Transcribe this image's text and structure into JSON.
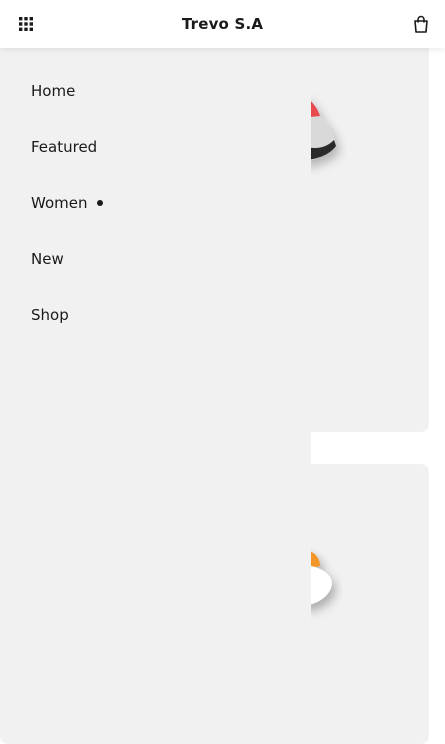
{
  "header": {
    "brand": "Trevo S.A",
    "menu_icon": "grid-icon",
    "cart_icon": "shopping-bag-icon"
  },
  "drawer": {
    "items": [
      {
        "label": "Home",
        "active": false
      },
      {
        "label": "Featured",
        "active": false
      },
      {
        "label": "Women",
        "active": true
      },
      {
        "label": "New",
        "active": false
      },
      {
        "label": "Shop",
        "active": false
      }
    ]
  },
  "colors": {
    "text": "#1a1a1a",
    "surface": "#f1f1f1",
    "background": "#ffffff"
  }
}
